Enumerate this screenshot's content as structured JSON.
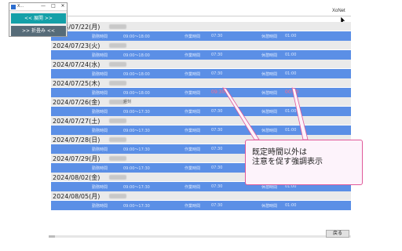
{
  "app": {
    "title": "X…",
    "brand": "XoNet"
  },
  "window": {
    "controls": [
      "—",
      "□",
      "✕"
    ],
    "open_button": "<< 展開 >>",
    "fold_button": ">> 折畳み <<"
  },
  "labels": {
    "work_time": "勤務時間",
    "overtime": "作業時間",
    "rest": "休憩時間"
  },
  "days": [
    {
      "date": "2024/07/22(月)",
      "note": "",
      "hours": "09:00～18:00",
      "ot": "07:30",
      "rest": "01:00",
      "warn": false
    },
    {
      "date": "2024/07/23(火)",
      "note": "",
      "hours": "09:00～18:00",
      "ot": "07:30",
      "rest": "01:00",
      "warn": false
    },
    {
      "date": "2024/07/24(水)",
      "note": "",
      "hours": "09:00～18:00",
      "ot": "07:30",
      "rest": "01:00",
      "warn": false
    },
    {
      "date": "2024/07/25(木)",
      "note": "",
      "hours": "09:00～18:00",
      "ot": "09:30",
      "rest": "00:00",
      "warn": true
    },
    {
      "date": "2024/07/26(金)",
      "note": "遅刻",
      "hours": "09:00～17:30",
      "ot": "07:30",
      "rest": "01:00",
      "warn": false
    },
    {
      "date": "2024/07/27(土)",
      "note": "",
      "hours": "09:00～17:30",
      "ot": "07:30",
      "rest": "01:00",
      "warn": false
    },
    {
      "date": "2024/07/28(日)",
      "note": "",
      "hours": "09:00～17:30",
      "ot": "07:30",
      "rest": "01:00",
      "warn": false
    },
    {
      "date": "2024/07/29(月)",
      "note": "",
      "hours": "09:00～17:30",
      "ot": "07:30",
      "rest": "01:00",
      "warn": false
    },
    {
      "date": "2024/08/02(金)",
      "note": "",
      "hours": "09:00～17:30",
      "ot": "07:30",
      "rest": "01:00",
      "warn": false
    },
    {
      "date": "2024/08/05(月)",
      "note": "",
      "hours": "09:00～17:30",
      "ot": "07:30",
      "rest": "01:00",
      "warn": false
    }
  ],
  "callout": {
    "text": "既定時間以外は\n注意を促す強調表示"
  },
  "footer": {
    "close_button": "戻る"
  },
  "colors": {
    "row_blue": "#5b8fe6",
    "warn": "#ff6a8a",
    "accent_teal": "#14a0a8",
    "callout_border": "#e05a9a"
  }
}
